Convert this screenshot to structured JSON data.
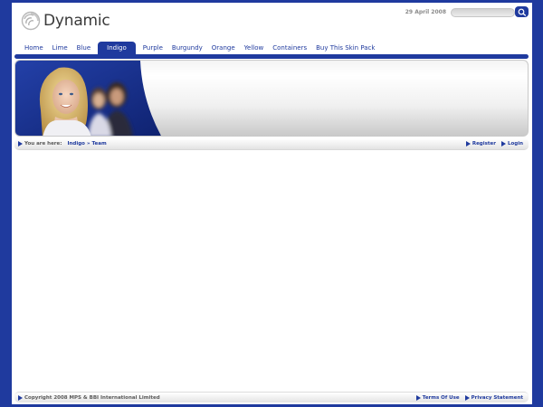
{
  "header": {
    "logo_text": "Dynamic",
    "date": "29 April 2008",
    "search": {
      "placeholder": ""
    }
  },
  "nav": {
    "items": [
      {
        "label": "Home"
      },
      {
        "label": "Lime"
      },
      {
        "label": "Blue"
      },
      {
        "label": "Indigo"
      },
      {
        "label": "Purple"
      },
      {
        "label": "Burgundy"
      },
      {
        "label": "Orange"
      },
      {
        "label": "Yellow"
      },
      {
        "label": "Containers"
      },
      {
        "label": "Buy This Skin Pack"
      }
    ],
    "active": "Indigo"
  },
  "breadcrumb": {
    "prefix": "You are here:",
    "items": [
      "Indigo",
      "Team"
    ],
    "separator": "»"
  },
  "account": {
    "register": "Register",
    "login": "Login"
  },
  "footer": {
    "copyright": "Copyright 2008 MPS & BBI International Limited",
    "terms": "Terms Of Use",
    "privacy": "Privacy Statement"
  },
  "colors": {
    "brand": "#1f3a9e",
    "background": "#1f3a9e",
    "page": "#ffffff"
  },
  "icons": {
    "logo": "swirl-logo-icon",
    "search": "magnifier-icon",
    "arrow": "arrow-right-icon"
  }
}
